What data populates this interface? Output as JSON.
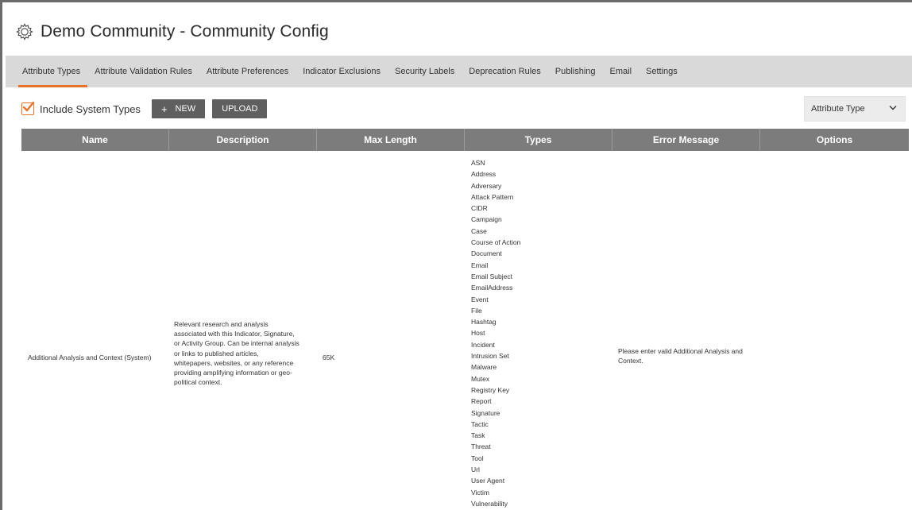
{
  "app": {
    "title": "Demo Community - Community Config"
  },
  "tabs": [
    {
      "label": "Attribute Types",
      "active": true
    },
    {
      "label": "Attribute Validation Rules",
      "active": false
    },
    {
      "label": "Attribute Preferences",
      "active": false
    },
    {
      "label": "Indicator Exclusions",
      "active": false
    },
    {
      "label": "Security Labels",
      "active": false
    },
    {
      "label": "Deprecation Rules",
      "active": false
    },
    {
      "label": "Publishing",
      "active": false
    },
    {
      "label": "Email",
      "active": false
    },
    {
      "label": "Settings",
      "active": false
    }
  ],
  "toolbar": {
    "include_system_label": "Include System Types",
    "include_system_checked": true,
    "new_label": "NEW",
    "new_icon": "plus-icon",
    "upload_label": "UPLOAD",
    "filter_value": "Attribute Type",
    "filter_icon": "chevron-down-icon"
  },
  "colors": {
    "accent": "#e8742a",
    "header_bg": "#7c7c7c",
    "tabs_bg": "#d9d9d9",
    "button_bg": "#5f5f5f"
  },
  "table": {
    "columns": [
      "Name",
      "Description",
      "Max Length",
      "Types",
      "Error Message",
      "Options"
    ],
    "rows": [
      {
        "name": "Additional Analysis and Context (System)",
        "description_lines": [
          "Relevant research and analysis",
          "associated with this Indicator, Signature,",
          "or Activity Group. Can be internal analysis",
          "or links to published articles,",
          "whitepapers, websites, or any reference",
          "providing amplifying information or geo-",
          "political context."
        ],
        "max_length": "65K",
        "types": [
          "ASN",
          "Address",
          "Adversary",
          "Attack Pattern",
          "CIDR",
          "Campaign",
          "Case",
          "Course of Action",
          "Document",
          "Email",
          "Email Subject",
          "EmailAddress",
          "Event",
          "File",
          "Hashtag",
          "Host",
          "Incident",
          "Intrusion Set",
          "Malware",
          "Mutex",
          "Registry Key",
          "Report",
          "Signature",
          "Tactic",
          "Task",
          "Threat",
          "Tool",
          "Url",
          "User Agent",
          "Victim",
          "Vulnerability"
        ],
        "error_message_lines": [
          "Please enter valid Additional Analysis and",
          "Context."
        ],
        "options": ""
      }
    ]
  }
}
